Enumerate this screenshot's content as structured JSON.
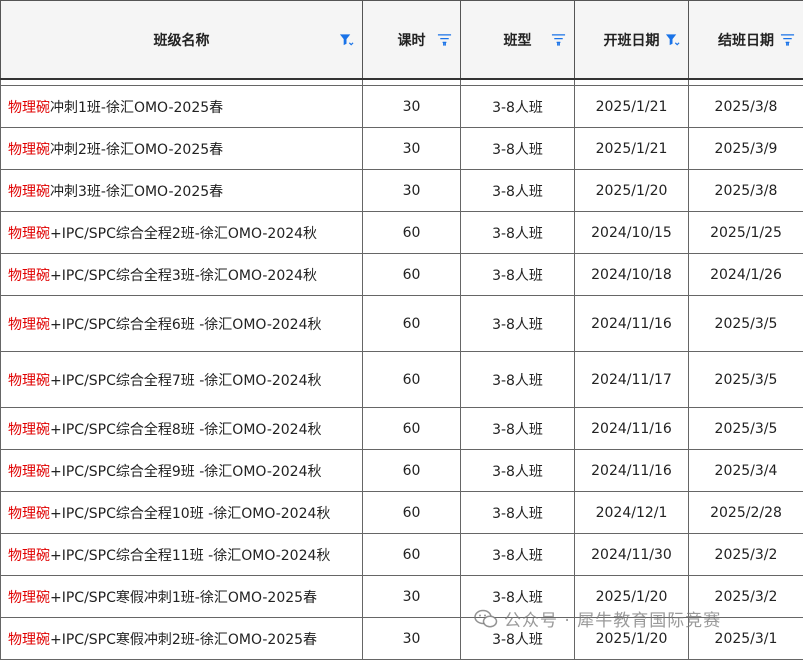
{
  "header": {
    "name": "班级名称",
    "hours": "课时",
    "type": "班型",
    "start": "开班日期",
    "end": "结班日期"
  },
  "colors": {
    "brand": "#e00000",
    "filter_active": "#1a73e8",
    "filter_inactive": "#1a73e8"
  },
  "rows": [
    {
      "brand": "物理碗",
      "rest": "冲刺1班-徐汇OMO-2025春",
      "hours": "30",
      "type": "3-8人班",
      "start": "2025/1/21",
      "end": "2025/3/8"
    },
    {
      "brand": "物理碗",
      "rest": "冲刺2班-徐汇OMO-2025春",
      "hours": "30",
      "type": "3-8人班",
      "start": "2025/1/21",
      "end": "2025/3/9"
    },
    {
      "brand": "物理碗",
      "rest": "冲刺3班-徐汇OMO-2025春",
      "hours": "30",
      "type": "3-8人班",
      "start": "2025/1/20",
      "end": "2025/3/8"
    },
    {
      "brand": "物理碗",
      "rest": "+IPC/SPC综合全程2班-徐汇OMO-2024秋",
      "hours": "60",
      "type": "3-8人班",
      "start": "2024/10/15",
      "end": "2025/1/25"
    },
    {
      "brand": "物理碗",
      "rest": "+IPC/SPC综合全程3班-徐汇OMO-2024秋",
      "hours": "60",
      "type": "3-8人班",
      "start": "2024/10/18",
      "end": "2024/1/26"
    },
    {
      "brand": "物理碗",
      "rest": "+IPC/SPC综合全程6班 -徐汇OMO-2024秋",
      "hours": "60",
      "type": "3-8人班",
      "start": "2024/11/16",
      "end": "2025/3/5"
    },
    {
      "brand": "物理碗",
      "rest": "+IPC/SPC综合全程7班 -徐汇OMO-2024秋",
      "hours": "60",
      "type": "3-8人班",
      "start": "2024/11/17",
      "end": "2025/3/5"
    },
    {
      "brand": "物理碗",
      "rest": "+IPC/SPC综合全程8班 -徐汇OMO-2024秋",
      "hours": "60",
      "type": "3-8人班",
      "start": "2024/11/16",
      "end": "2025/3/5"
    },
    {
      "brand": "物理碗",
      "rest": "+IPC/SPC综合全程9班 -徐汇OMO-2024秋",
      "hours": "60",
      "type": "3-8人班",
      "start": "2024/11/16",
      "end": "2025/3/4"
    },
    {
      "brand": "物理碗",
      "rest": "+IPC/SPC综合全程10班 -徐汇OMO-2024秋",
      "hours": "60",
      "type": "3-8人班",
      "start": "2024/12/1",
      "end": "2025/2/28"
    },
    {
      "brand": "物理碗",
      "rest": "+IPC/SPC综合全程11班 -徐汇OMO-2024秋",
      "hours": "60",
      "type": "3-8人班",
      "start": "2024/11/30",
      "end": "2025/3/2"
    },
    {
      "brand": "物理碗",
      "rest": "+IPC/SPC寒假冲刺1班-徐汇OMO-2025春",
      "hours": "30",
      "type": "3-8人班",
      "start": "2025/1/20",
      "end": "2025/3/2"
    },
    {
      "brand": "物理碗",
      "rest": "+IPC/SPC寒假冲刺2班-徐汇OMO-2025春",
      "hours": "30",
      "type": "3-8人班",
      "start": "2025/1/20",
      "end": "2025/3/1"
    }
  ],
  "watermark": "公众号 · 犀牛教育国际竞赛"
}
